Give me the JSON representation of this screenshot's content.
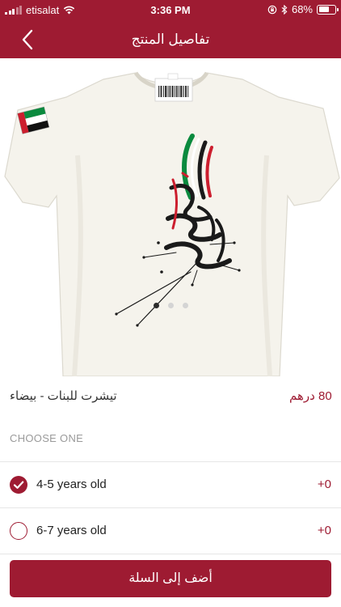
{
  "status_bar": {
    "carrier": "etisalat",
    "time": "3:36 PM",
    "battery": "68%",
    "battery_level": 0.68,
    "icons": [
      "signal-icon",
      "wifi-icon",
      "orientation-lock-icon",
      "bluetooth-icon",
      "battery-icon"
    ]
  },
  "nav": {
    "title": "تفاصيل المنتج",
    "back_icon": "chevron-left-icon"
  },
  "gallery": {
    "image_count": 3,
    "active_index": 0,
    "image": "white-tshirt-arabic-calligraphy"
  },
  "product": {
    "name": "تيشرت للبنات - بيضاء",
    "price": "80 درهم"
  },
  "options": {
    "section_title": "CHOOSE ONE",
    "items": [
      {
        "label": "4-5 years old",
        "price_delta": "+0",
        "selected": true
      },
      {
        "label": "6-7 years old",
        "price_delta": "+0",
        "selected": false
      }
    ]
  },
  "cart_button": {
    "label": "أضف إلى السلة"
  },
  "colors": {
    "brand": "#9e1b32",
    "muted_text": "#9a9a9a",
    "divider": "#e6e6e6",
    "shirt": "#f5f3ec"
  }
}
